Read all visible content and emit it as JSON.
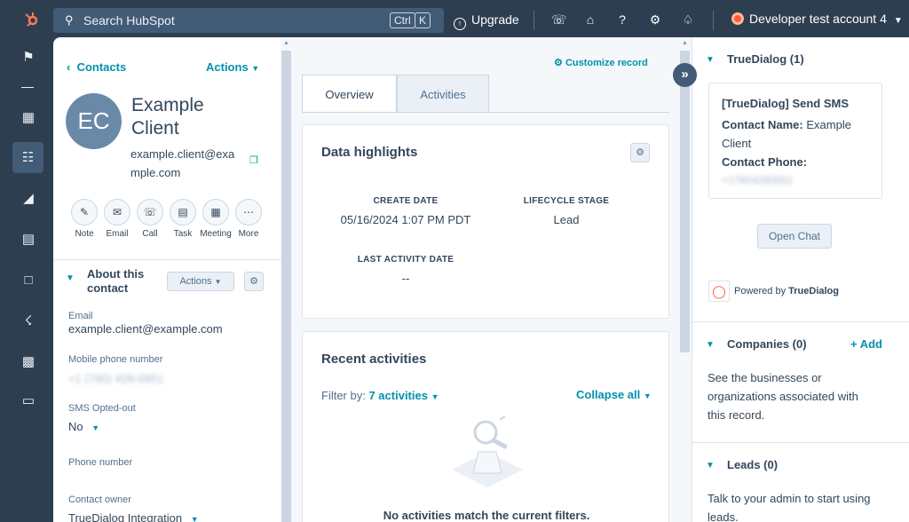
{
  "topnav": {
    "search_placeholder": "Search HubSpot",
    "kbd_ctrl": "Ctrl",
    "kbd_k": "K",
    "upgrade_label": "Upgrade",
    "account_name": "Developer test account 4"
  },
  "record": {
    "back_label": "Contacts",
    "actions_label": "Actions",
    "avatar_initials": "EC",
    "name": "Example Client",
    "email": "example.client@example.com"
  },
  "quick_actions": [
    {
      "label": "Note"
    },
    {
      "label": "Email"
    },
    {
      "label": "Call"
    },
    {
      "label": "Task"
    },
    {
      "label": "Meeting"
    },
    {
      "label": "More"
    }
  ],
  "about": {
    "title": "About this contact",
    "actions_label": "Actions",
    "props": [
      {
        "label": "Email",
        "value": "example.client@example.com"
      },
      {
        "label": "Mobile phone number",
        "value": "+1 (760) 428-0951"
      },
      {
        "label": "SMS Opted-out",
        "value": "No"
      },
      {
        "label": "Phone number",
        "value": ""
      },
      {
        "label": "Contact owner",
        "value": "TrueDialog Integration"
      }
    ]
  },
  "middle": {
    "customize_label": "Customize record",
    "tabs": [
      {
        "label": "Overview"
      },
      {
        "label": "Activities"
      }
    ]
  },
  "highlights": {
    "title": "Data highlights",
    "items": [
      {
        "label": "CREATE DATE",
        "value": "05/16/2024 1:07 PM PDT"
      },
      {
        "label": "LIFECYCLE STAGE",
        "value": "Lead"
      },
      {
        "label": "LAST ACTIVITY DATE",
        "value": "--"
      }
    ]
  },
  "recent": {
    "title": "Recent activities",
    "filter_label": "Filter by:",
    "filter_value": "7 activities",
    "collapse_label": "Collapse all",
    "empty_text": "No activities match the current filters."
  },
  "right": {
    "truedialog": {
      "title": "TrueDialog (1)",
      "box_title": "[TrueDialog] Send SMS",
      "contact_name_label": "Contact Name:",
      "contact_name_value": "Example Client",
      "contact_phone_label": "Contact Phone:",
      "contact_phone_value": "+17604280951",
      "open_chat_label": "Open Chat",
      "powered_prefix": "Powered by",
      "powered_brand": "TrueDialog"
    },
    "companies": {
      "title": "Companies (0)",
      "add_label": "+ Add",
      "text": "See the businesses or organizations associated with this record."
    },
    "leads": {
      "title": "Leads (0)",
      "text": "Talk to your admin to start using leads."
    }
  },
  "colors": {
    "accent": "#0091ae",
    "nav_bg": "#2d3e50",
    "brand": "#ff7a59"
  },
  "icons": [
    "hubspot-logo-icon",
    "search-icon",
    "upgrade-icon",
    "phone-icon",
    "marketplace-icon",
    "help-icon",
    "settings-icon",
    "notification-icon",
    "bookmark-icon",
    "apps-icon",
    "contacts-icon",
    "megaphone-icon",
    "document-icon",
    "wallet-icon",
    "network-icon",
    "chart-icon",
    "folder-icon",
    "copy-icon",
    "gear-icon",
    "chevron-down-icon",
    "double-chevron-right-icon"
  ]
}
